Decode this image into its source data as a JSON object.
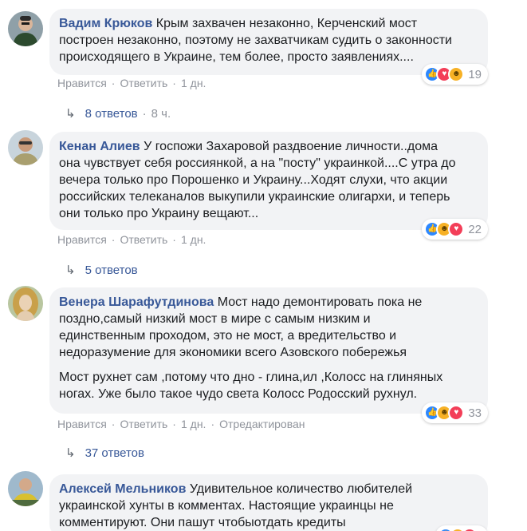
{
  "comments": [
    {
      "author": "Вадим Крюков",
      "lines": [
        "Крым захвачен незаконно, Керченский мост",
        "построен незаконно, поэтому не захватчикам судить о законности",
        "происходящего в Украине, тем более, просто заявлениях...."
      ],
      "like": "Нравится",
      "reply": "Ответить",
      "time": "1 дн.",
      "reaction_count": "19",
      "reaction_icons": [
        "like-icon",
        "love-icon",
        "haha-icon"
      ],
      "replies": "8 ответов",
      "replies_time": "8 ч."
    },
    {
      "author": "Кенан Алиев",
      "lines": [
        "У госпожи Захаровой раздвоение личности..дома",
        "она чувствует себя россиянкой, а на \"посту\" украинкой....С утра до",
        "вечера только про Порошенко и Украину...Ходят слухи, что акции",
        "российских телеканалов выкупили украинские олигархи, и теперь",
        "они только про Украину вещают..."
      ],
      "like": "Нравится",
      "reply": "Ответить",
      "time": "1 дн.",
      "reaction_count": "22",
      "reaction_icons": [
        "like-icon",
        "haha-icon",
        "love-icon"
      ],
      "replies": "5 ответов"
    },
    {
      "author": "Венера Шарафутдинова",
      "lines": [
        "Мост надо демонтировать пока не",
        "поздно,самый низкий мост в мире с самым низким и",
        "единственным проходом, это не мост, а вредительство и",
        "недоразумение для экономики всего Азовского побережья"
      ],
      "lines2": [
        "Мост рухнет сам ,потому что дно - глина,ил ,Колосс на глиняных",
        "ногах. Уже было такое чудо света Колосс Родосский рухнул."
      ],
      "like": "Нравится",
      "reply": "Ответить",
      "time": "1 дн.",
      "edited": "Отредактирован",
      "reaction_count": "33",
      "reaction_icons": [
        "like-icon",
        "haha-icon",
        "love-icon"
      ],
      "replies": "37 ответов"
    },
    {
      "author": "Алексей Мельников",
      "lines": [
        "Удивительное количество любителей",
        "украинской хунты в комментах. Настоящие украинцы не",
        "комментируют. Они пашут чтобыотдать кредиты"
      ],
      "reaction_icons": [
        "like-icon",
        "haha-icon",
        "love-icon"
      ]
    }
  ]
}
